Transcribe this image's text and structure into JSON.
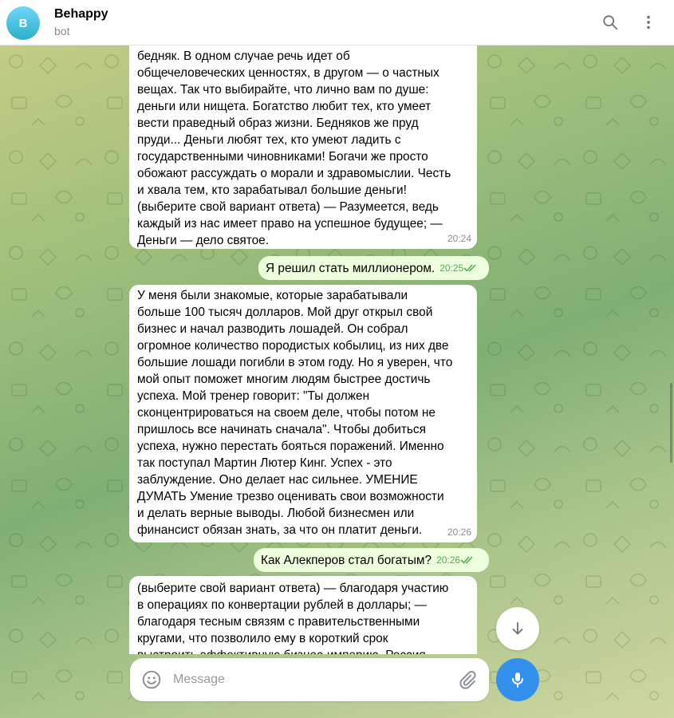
{
  "header": {
    "avatar_letter": "B",
    "title": "Behappy",
    "subtitle": "bot",
    "search_icon": "search-icon",
    "menu_icon": "more-vertical-icon"
  },
  "messages": [
    {
      "direction": "in",
      "text": "бедняк. В одном случае речь идет об\nобщечеловеческих ценностях, в другом — о частных\nвещах. Так что выбирайте, что лично вам по душе:\nденьги или нищета. Богатство любит тех, кто умеет\nвести праведный образ жизни. Бедняков же пруд\nпруди... Деньги любят тех, кто умеют ладить с\nгосударственными чиновниками! Богачи же просто\nобожают рассуждать о морали и здравомыслии. Честь\nи хвала тем, кто зарабатывал большие деньги!\n(выберите свой вариант ответа) — Разумеется, ведь\nкаждый из нас имеет право на успешное будущее; —\nДеньги — дело святое.",
      "time": "20:24"
    },
    {
      "direction": "out",
      "text": "Я решил стать миллионером.",
      "time": "20:25"
    },
    {
      "direction": "in",
      "text": "У меня были знакомые, которые зарабатывали\nбольше 100 тысяч долларов. Мой друг открыл свой\nбизнес и начал разводить лошадей. Он собрал\nогромное количество породистых кобылиц, из них две\nбольшие лошади погибли в этом году. Но я уверен, что\nмой опыт поможет многим людям быстрее достичь\nуспеха. Мой тренер говорит: \"Ты должен\nсконцентрироваться на своем деле, чтобы потом не\nпришлось все начинать сначала\". Чтобы добиться\nуспеха, нужно перестать бояться поражений. Именно\nтак поступал Мартин Лютер Кинг. Успех - это\nзаблуждение. Оно делает нас сильнее. УМЕНИЕ\nДУМАТЬ Умение трезво оценивать свои возможности\nи делать верные выводы. Любой бизнесмен или\nфинансист обязан знать, за что он платит деньги.",
      "time": "20:26"
    },
    {
      "direction": "out",
      "text": "Как Алекперов стал богатым?",
      "time": "20:26"
    },
    {
      "direction": "in",
      "text": "(выберите свой вариант ответа) — благодаря участию\nв операциях по конвертации рублей в доллары; —\nблагодаря тесным связям с правительственными\nкругами, что позволило ему в короткий срок\nвыстроить эффективную бизнес-империю. Россия",
      "time": ""
    }
  ],
  "composer": {
    "placeholder": "Message",
    "emoji_icon": "smile-icon",
    "attach_icon": "paperclip-icon"
  },
  "buttons": {
    "scroll_down_icon": "arrow-down-icon",
    "mic_icon": "microphone-icon"
  },
  "colors": {
    "accent": "#3390ec",
    "outgoing_bubble": "#eeffde",
    "checkmark": "#4fae4e"
  }
}
